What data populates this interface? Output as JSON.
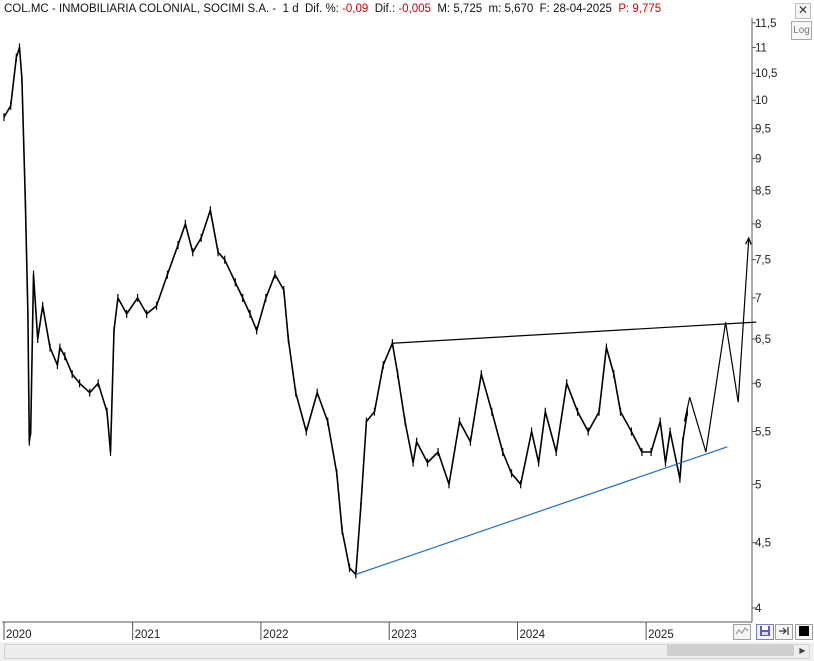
{
  "header": {
    "symbol": "COL.MC - INMOBILIARIA COLONIAL, SOCIMI S.A. -",
    "period": "1 d",
    "dif_pct_label": "Dif. %:",
    "dif_pct_value": "-0,09",
    "dif_label": "Dif.:",
    "dif_value": "-0,005",
    "max_label": "M:",
    "max_value": "5,725",
    "min_label": "m:",
    "min_value": "5,670",
    "date_label": "F:",
    "date_value": "28-04-2025",
    "p_label": "P:",
    "p_value": "9,775"
  },
  "controls": {
    "close_glyph": "✕",
    "log_label": "Log"
  },
  "colors": {
    "price": "#000000",
    "support_trendline": "#1f6fc4",
    "resistance_trendline": "#000000",
    "negative_value": "#d40000",
    "grid": "#e6e6e6"
  },
  "icons": [
    "close-icon",
    "log-scale-button",
    "chart-style-icon",
    "save-icon",
    "move-icon",
    "color-swatch-icon",
    "scroll-right-icon"
  ],
  "chart_data": {
    "type": "line",
    "y_scale": "log",
    "ylim": [
      3.9,
      11.6
    ],
    "xlim": [
      "2020-01-01",
      "2025-12-31"
    ],
    "y_ticks": [
      "11,5",
      "11",
      "10,5",
      "10",
      "9,5",
      "9",
      "8,5",
      "8",
      "7,5",
      "7",
      "6,5",
      "6",
      "5,5",
      "5",
      "4,5",
      "4"
    ],
    "x_ticks": [
      "2020",
      "2021",
      "2022",
      "2023",
      "2024",
      "2025"
    ],
    "grid": false,
    "series": [
      {
        "x": [
          "2020-01-01",
          "2020-01-20",
          "2020-02-05",
          "2020-02-14",
          "2020-02-21",
          "2020-03-02",
          "2020-03-09",
          "2020-03-13",
          "2020-03-17",
          "2020-03-25",
          "2020-04-06",
          "2020-04-20",
          "2020-05-11",
          "2020-06-01",
          "2020-06-08",
          "2020-06-22",
          "2020-07-13",
          "2020-08-03",
          "2020-09-01",
          "2020-09-25",
          "2020-10-20",
          "2020-10-30",
          "2020-11-09",
          "2020-11-20",
          "2020-12-15",
          "2021-01-15",
          "2021-02-10",
          "2021-03-10",
          "2021-04-10",
          "2021-05-10",
          "2021-05-31",
          "2021-06-21",
          "2021-07-15",
          "2021-08-10",
          "2021-09-01",
          "2021-09-20",
          "2021-10-20",
          "2021-11-10",
          "2021-12-01",
          "2021-12-20",
          "2022-01-15",
          "2022-02-10",
          "2022-03-07",
          "2022-03-20",
          "2022-04-10",
          "2022-05-10",
          "2022-06-10",
          "2022-07-10",
          "2022-08-05",
          "2022-08-20",
          "2022-09-10",
          "2022-09-28",
          "2022-10-12",
          "2022-10-28",
          "2022-11-20",
          "2022-12-15",
          "2023-01-10",
          "2023-01-25",
          "2023-02-15",
          "2023-03-10",
          "2023-03-20",
          "2023-04-20",
          "2023-05-20",
          "2023-06-20",
          "2023-07-20",
          "2023-08-20",
          "2023-09-20",
          "2023-10-20",
          "2023-11-20",
          "2023-12-15",
          "2024-01-10",
          "2024-02-10",
          "2024-03-01",
          "2024-03-20",
          "2024-04-20",
          "2024-05-20",
          "2024-06-20",
          "2024-07-20",
          "2024-08-20",
          "2024-09-10",
          "2024-10-01",
          "2024-10-20",
          "2024-11-20",
          "2024-12-20",
          "2025-01-15",
          "2025-02-10",
          "2025-02-25",
          "2025-03-10",
          "2025-04-07",
          "2025-04-15",
          "2025-04-28"
        ],
        "values": [
          9.7,
          9.9,
          10.8,
          11.0,
          10.4,
          8.3,
          6.8,
          5.4,
          5.5,
          7.3,
          6.5,
          6.9,
          6.4,
          6.2,
          6.4,
          6.3,
          6.1,
          6.0,
          5.9,
          6.0,
          5.7,
          5.3,
          6.6,
          7.0,
          6.8,
          7.0,
          6.8,
          6.9,
          7.3,
          7.7,
          8.0,
          7.6,
          7.8,
          8.2,
          7.6,
          7.5,
          7.2,
          7.0,
          6.8,
          6.6,
          7.0,
          7.3,
          7.1,
          6.5,
          5.9,
          5.5,
          5.9,
          5.6,
          5.1,
          4.6,
          4.3,
          4.25,
          4.8,
          5.6,
          5.7,
          6.2,
          6.45,
          6.1,
          5.6,
          5.2,
          5.4,
          5.2,
          5.3,
          5.0,
          5.6,
          5.4,
          6.1,
          5.7,
          5.3,
          5.1,
          5.0,
          5.5,
          5.2,
          5.7,
          5.3,
          6.0,
          5.7,
          5.5,
          5.7,
          6.4,
          6.1,
          5.7,
          5.5,
          5.3,
          5.3,
          5.6,
          5.2,
          5.5,
          5.05,
          5.4,
          5.7
        ]
      }
    ],
    "annotations": [
      {
        "type": "support_trendline",
        "from": {
          "x": "2022-09-28",
          "y": 4.25
        },
        "to": {
          "x": "2025-08-20",
          "y": 5.35
        }
      },
      {
        "type": "resistance_trendline",
        "from": {
          "x": "2023-01-10",
          "y": 6.45
        },
        "to": {
          "x": "2025-11-10",
          "y": 6.7
        }
      },
      {
        "type": "projection_path",
        "points": [
          {
            "x": "2025-04-20",
            "y": 5.6
          },
          {
            "x": "2025-05-05",
            "y": 5.85
          },
          {
            "x": "2025-06-20",
            "y": 5.3
          },
          {
            "x": "2025-08-15",
            "y": 6.7
          },
          {
            "x": "2025-09-20",
            "y": 5.8
          },
          {
            "x": "2025-10-20",
            "y": 7.8
          }
        ]
      }
    ]
  }
}
